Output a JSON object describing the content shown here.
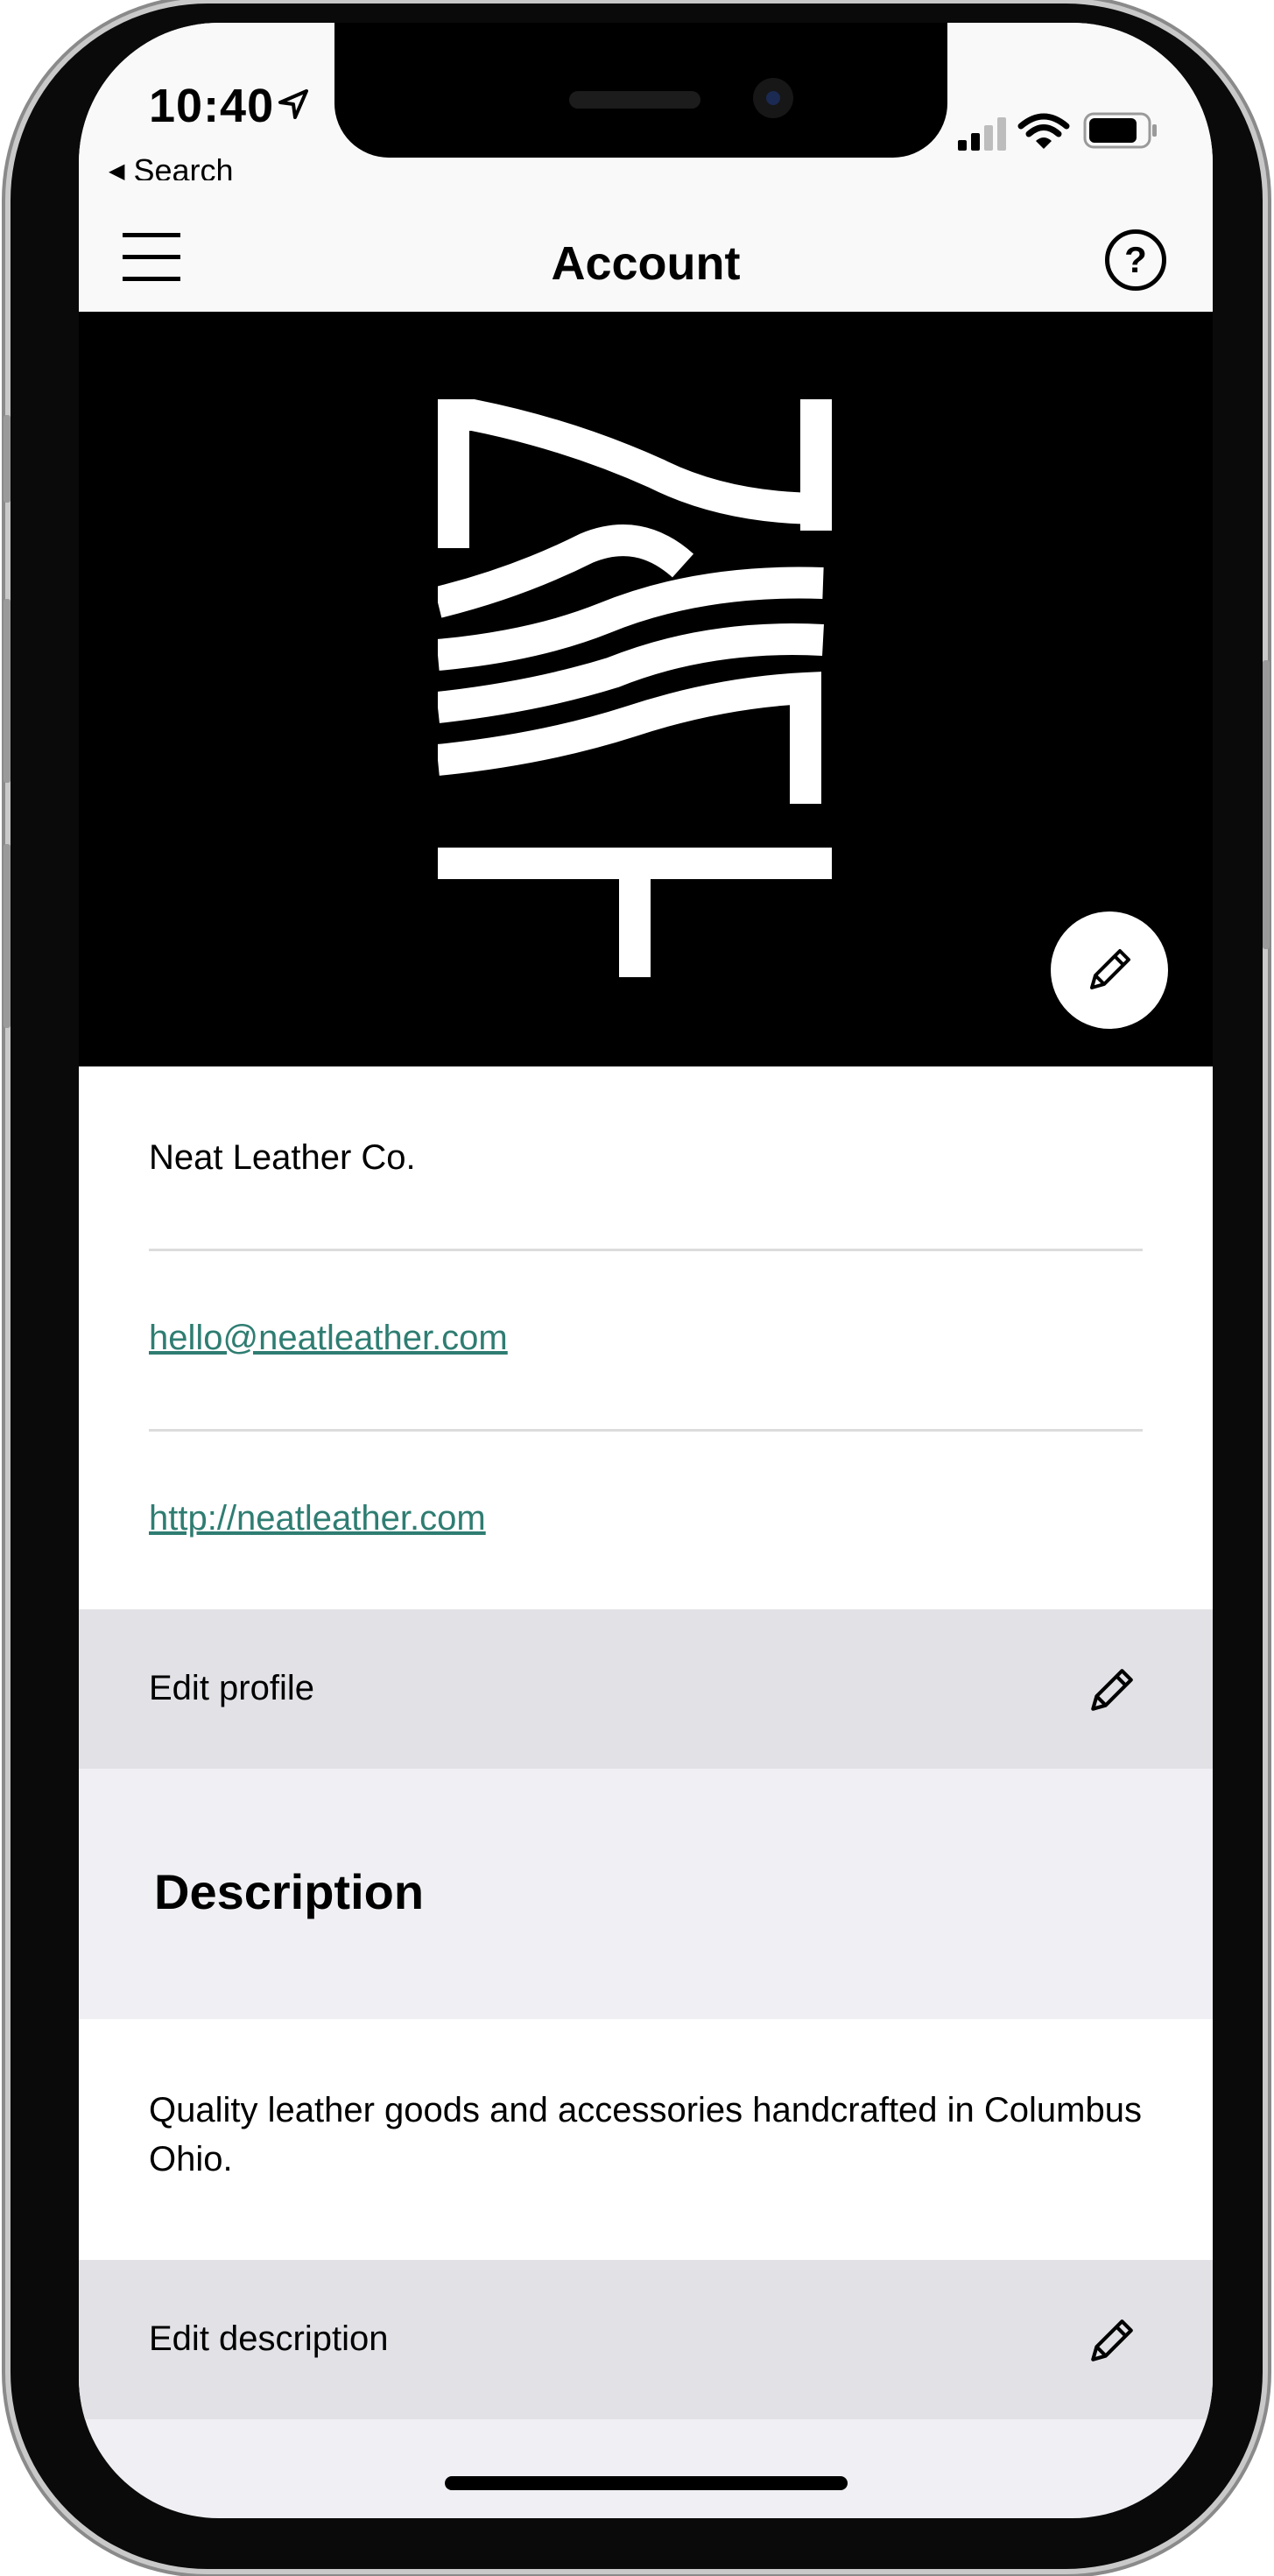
{
  "status_bar": {
    "time": "10:40",
    "back_label": "Search"
  },
  "nav": {
    "title": "Account",
    "menu_icon": "hamburger-menu-icon",
    "help_icon": "question-mark-icon"
  },
  "profile": {
    "name": "Neat Leather Co.",
    "email": "hello@neatleather.com",
    "website": "http://neatleather.com",
    "edit_label": "Edit profile"
  },
  "description": {
    "heading": "Description",
    "text": "Quality leather goods and accessories handcrafted in Columbus Ohio.",
    "edit_label": "Edit description"
  },
  "colors": {
    "link": "#2f7d72",
    "edit_row_bg": "#e1e1e6",
    "section_bg": "#f0f0f4"
  }
}
